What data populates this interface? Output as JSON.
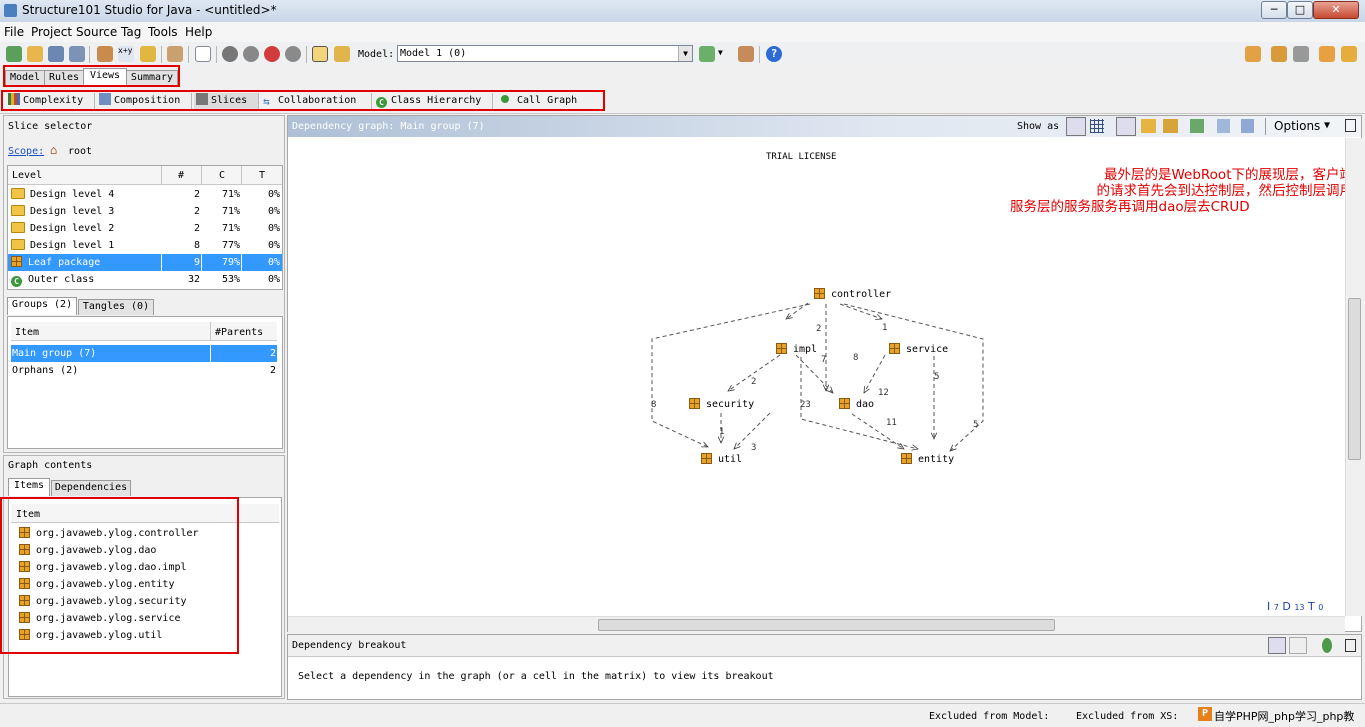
{
  "window": {
    "title": "Structure101 Studio for Java - <untitled>*",
    "min": "─",
    "max": "□",
    "close": "✕"
  },
  "menu": [
    "File",
    "Project",
    "Source",
    "Tag",
    "Tools",
    "Help"
  ],
  "toolbar": {
    "model_label": "Model:",
    "model_value": "Model 1 (0)"
  },
  "tabs": [
    "Model",
    "Rules",
    "Views",
    "Summary"
  ],
  "active_tab": "Views",
  "views": [
    "Complexity",
    "Composition",
    "Slices",
    "Collaboration",
    "Class Hierarchy",
    "Call Graph"
  ],
  "slice_selector": {
    "title": "Slice selector",
    "scope_label": "Scope:",
    "scope_value": "root",
    "columns": [
      "Level",
      "#",
      "C",
      "T"
    ],
    "rows": [
      {
        "name": "Design level 4",
        "count": "2",
        "c": "71%",
        "t": "0%"
      },
      {
        "name": "Design level 3",
        "count": "2",
        "c": "71%",
        "t": "0%"
      },
      {
        "name": "Design level 2",
        "count": "2",
        "c": "71%",
        "t": "0%"
      },
      {
        "name": "Design level 1",
        "count": "8",
        "c": "77%",
        "t": "0%"
      },
      {
        "name": "Leaf package",
        "count": "9",
        "c": "79%",
        "t": "0%"
      },
      {
        "name": "Outer class",
        "count": "32",
        "c": "53%",
        "t": "0%"
      }
    ],
    "selected_row": 4
  },
  "groups": {
    "tabs": [
      "Groups (2)",
      "Tangles (0)"
    ],
    "columns": [
      "Item",
      "#Parents"
    ],
    "rows": [
      {
        "name": "Main group (7)",
        "parents": "2"
      },
      {
        "name": "Orphans (2)",
        "parents": "2"
      }
    ]
  },
  "graph_contents": {
    "title": "Graph contents",
    "tabs": [
      "Items",
      "Dependencies"
    ],
    "column": "Item",
    "items": [
      "org.javaweb.ylog.controller",
      "org.javaweb.ylog.dao",
      "org.javaweb.ylog.dao.impl",
      "org.javaweb.ylog.entity",
      "org.javaweb.ylog.security",
      "org.javaweb.ylog.service",
      "org.javaweb.ylog.util"
    ]
  },
  "graph": {
    "header": "Dependency graph: Main group (7)",
    "show_as": "Show as",
    "options": "Options",
    "license": "TRIAL LICENSE",
    "annotation_lines": [
      "最外层的是WebRoot下的展现层，客户端",
      "的请求首先会到达控制层，然后控制层调用",
      "服务层的服务服务再调用dao层去CRUD"
    ],
    "annotation_color": "#e00000",
    "nodes": [
      "controller",
      "impl",
      "service",
      "security",
      "dao",
      "util",
      "entity"
    ],
    "edge_labels": [
      "2",
      "1",
      "7",
      "8",
      "2",
      "12",
      "5",
      "8",
      "23",
      "1",
      "3",
      "11",
      "5"
    ],
    "stats": {
      "i": "I",
      "i_val": "7",
      "d": "D",
      "d_val": "13",
      "t": "T",
      "t_val": "0"
    }
  },
  "breakout": {
    "title": "Dependency breakout",
    "message": "Select a dependency in the graph (or a cell in the matrix) to view its breakout"
  },
  "status": {
    "excluded_model": "Excluded from Model:",
    "excluded_xs": "Excluded from XS:",
    "watermark": "自学PHP网_php学习_php教"
  }
}
